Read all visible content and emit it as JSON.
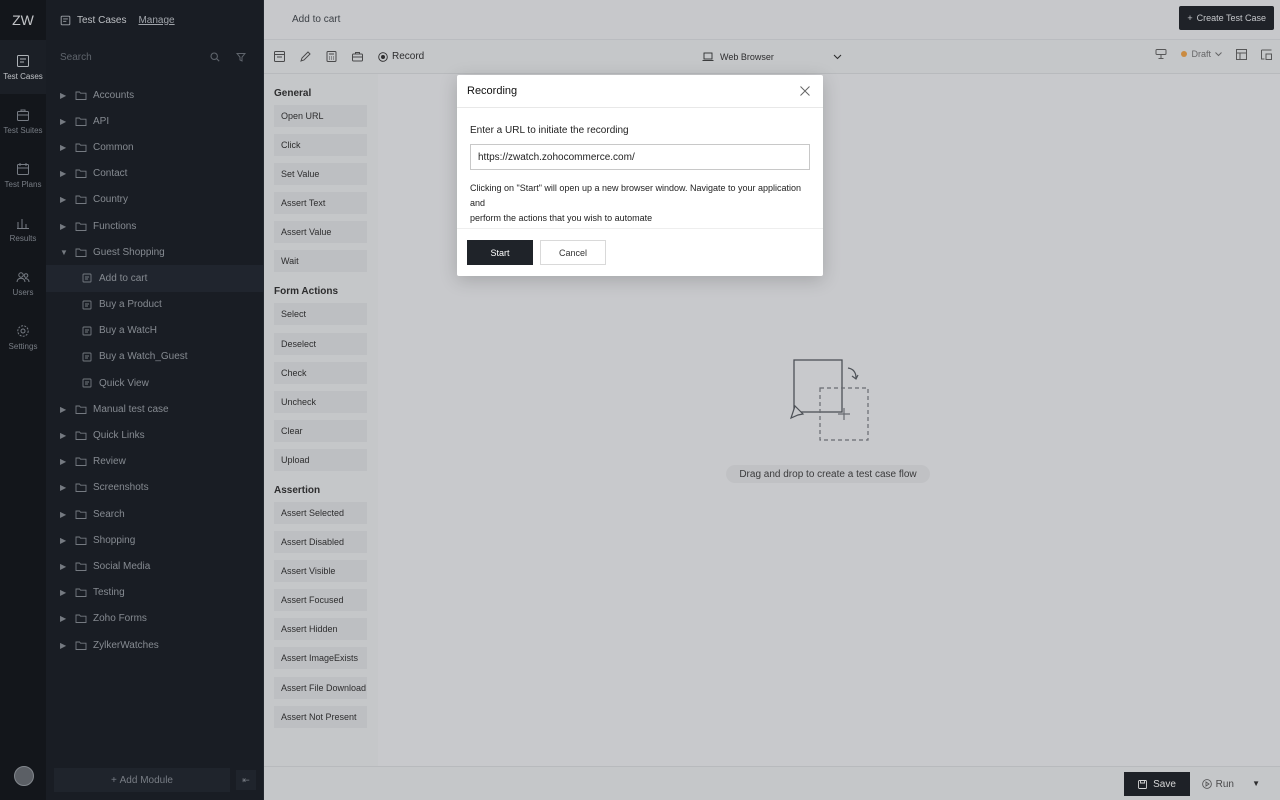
{
  "app": {
    "logo": "ZW"
  },
  "rail": [
    {
      "label": "Test Cases",
      "icon": "test-cases-icon"
    },
    {
      "label": "Test Suites",
      "icon": "test-suites-icon"
    },
    {
      "label": "Test Plans",
      "icon": "test-plans-icon"
    },
    {
      "label": "Results",
      "icon": "results-icon"
    },
    {
      "label": "Users",
      "icon": "users-icon"
    },
    {
      "label": "Settings",
      "icon": "settings-icon"
    }
  ],
  "sidebar": {
    "title": "Test Cases",
    "manage": "Manage",
    "search_placeholder": "Search",
    "tree": [
      {
        "label": "Accounts"
      },
      {
        "label": "API"
      },
      {
        "label": "Common"
      },
      {
        "label": "Contact"
      },
      {
        "label": "Country"
      },
      {
        "label": "Functions"
      },
      {
        "label": "Guest Shopping"
      },
      {
        "label": "Add to cart"
      },
      {
        "label": "Buy a Product"
      },
      {
        "label": "Buy a WatcH"
      },
      {
        "label": "Buy a Watch_Guest"
      },
      {
        "label": "Quick View"
      },
      {
        "label": "Manual test case"
      },
      {
        "label": "Quick Links"
      },
      {
        "label": "Review"
      },
      {
        "label": "Screenshots"
      },
      {
        "label": "Search"
      },
      {
        "label": "Shopping"
      },
      {
        "label": "Social Media"
      },
      {
        "label": "Testing"
      },
      {
        "label": "Zoho Forms"
      },
      {
        "label": "ZylkerWatches"
      }
    ],
    "add_module": "Add Module"
  },
  "header": {
    "breadcrumb": "Add to cart",
    "create_button": "Create Test Case"
  },
  "toolbar": {
    "record_label": "Record",
    "browser_label": "Web Browser",
    "status": "Draft",
    "status_color": "#f2a54a"
  },
  "palette": {
    "sections": [
      {
        "title": "General",
        "items": [
          "Open URL",
          "Click",
          "Set Value",
          "Assert Text",
          "Assert Value",
          "Wait"
        ]
      },
      {
        "title": "Form Actions",
        "items": [
          "Select",
          "Deselect",
          "Check",
          "Uncheck",
          "Clear",
          "Upload"
        ]
      },
      {
        "title": "Assertion",
        "items": [
          "Assert Selected",
          "Assert Disabled",
          "Assert Visible",
          "Assert Focused",
          "Assert Hidden",
          "Assert ImageExists",
          "Assert File Download",
          "Assert Not Present"
        ]
      }
    ]
  },
  "canvas": {
    "hint": "Drag and drop to create a test case flow"
  },
  "footer": {
    "save_label": "Save",
    "run_label": "Run"
  },
  "modal": {
    "title": "Recording",
    "url_label": "Enter a URL to initiate the recording",
    "url_value": "https://zwatch.zohocommerce.com/",
    "help_line1": "Clicking on \"Start\" will open up a new browser window. Navigate to your application and",
    "help_line2": "perform the actions that you wish to automate",
    "start_label": "Start",
    "cancel_label": "Cancel"
  }
}
